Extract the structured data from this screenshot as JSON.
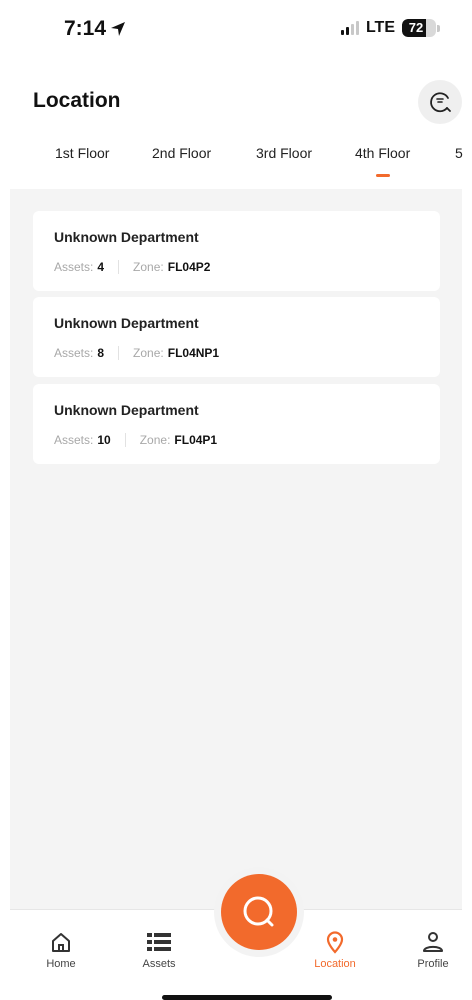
{
  "status_bar": {
    "time": "7:14",
    "network": "LTE",
    "battery": "72",
    "battery_level": 0.72
  },
  "header": {
    "title": "Location"
  },
  "tabs": [
    {
      "label": "1st Floor"
    },
    {
      "label": "2nd Floor"
    },
    {
      "label": "3rd Floor"
    },
    {
      "label": "4th Floor"
    },
    {
      "label": "5"
    }
  ],
  "departments": [
    {
      "name": "Unknown Department",
      "assets_label": "Assets:",
      "assets": "4",
      "zone_label": "Zone:",
      "zone": "FL04P2"
    },
    {
      "name": "Unknown Department",
      "assets_label": "Assets:",
      "assets": "8",
      "zone_label": "Zone:",
      "zone": "FL04NP1"
    },
    {
      "name": "Unknown Department",
      "assets_label": "Assets:",
      "assets": "10",
      "zone_label": "Zone:",
      "zone": "FL04P1"
    }
  ],
  "nav": {
    "home": "Home",
    "assets": "Assets",
    "location": "Location",
    "profile": "Profile"
  },
  "colors": {
    "accent": "#f26a2c",
    "background": "#f4f4f4"
  },
  "icons": [
    "location-arrow-icon",
    "signal-icon",
    "battery-icon",
    "filter-icon",
    "home-icon",
    "list-icon",
    "search-icon",
    "location-pin-icon",
    "profile-icon"
  ]
}
